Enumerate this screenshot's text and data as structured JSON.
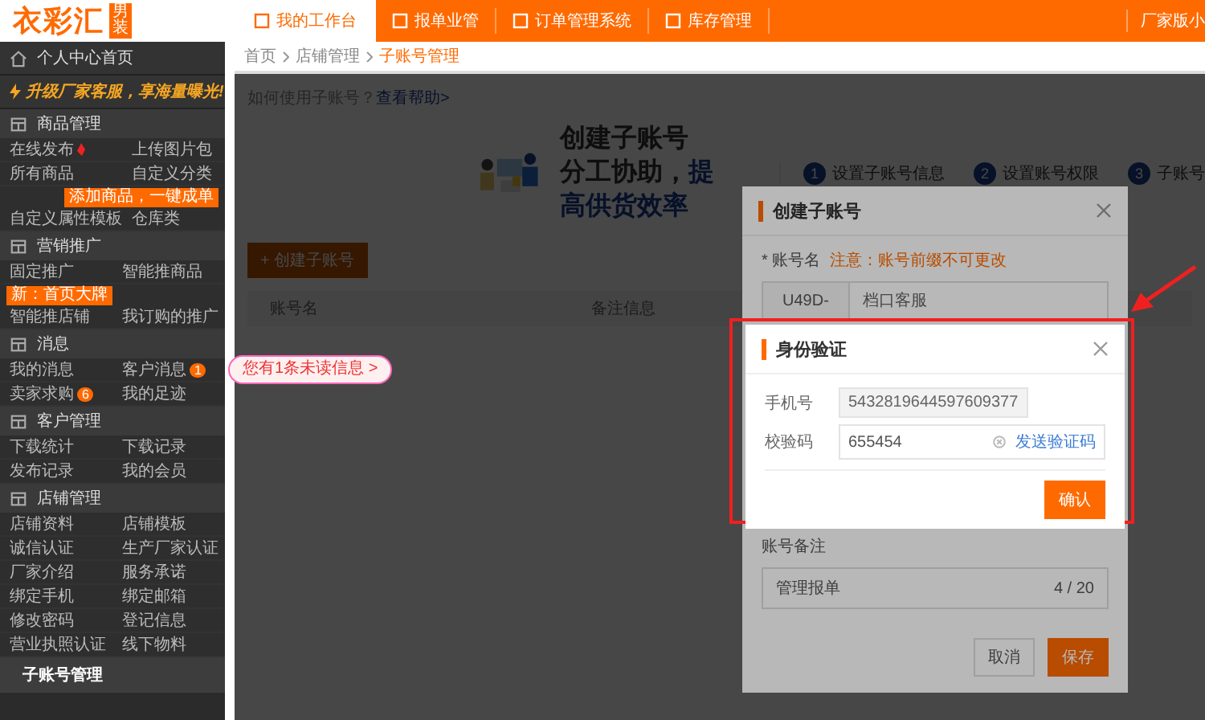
{
  "header": {
    "logo": "衣彩汇",
    "logo_tag": "男装",
    "tabs": [
      {
        "label": "我的工作台",
        "selected": true
      },
      {
        "label": "报单业管",
        "selected": false
      },
      {
        "label": "订单管理系统",
        "selected": false
      },
      {
        "label": "库存管理",
        "selected": false
      }
    ],
    "account": "厂家版小"
  },
  "sidebar": {
    "home": "个人中心首页",
    "promo": "升级厂家客服，享海量曝光!",
    "sections": [
      {
        "title": "商品管理",
        "items": [
          {
            "label": "在线发布",
            "hot": true
          },
          {
            "label": "上传图片包"
          },
          {
            "label": "所有商品"
          },
          {
            "label": "自定义分类",
            "tip": {
              "kind": "label",
              "text": "添加商品，一键成单"
            }
          },
          {
            "label": "自定义属性模板"
          },
          {
            "label": "仓库类"
          }
        ]
      },
      {
        "title": "营销推广",
        "items": [
          {
            "label": "固定推广",
            "tip": {
              "kind": "label",
              "text": "新：首页大牌"
            }
          },
          {
            "label": "智能推商品"
          },
          {
            "label": "智能推店铺"
          },
          {
            "label": "我订购的推广"
          }
        ]
      },
      {
        "title": "消息",
        "items": [
          {
            "label": "我的消息"
          },
          {
            "label": "客户消息",
            "badge": "1",
            "tip": {
              "kind": "bubble",
              "text": "您有1条未读信息 >"
            }
          },
          {
            "label": "卖家求购",
            "badge": "6"
          },
          {
            "label": "我的足迹"
          }
        ]
      },
      {
        "title": "客户管理",
        "items": [
          {
            "label": "下载统计"
          },
          {
            "label": "下载记录"
          },
          {
            "label": "发布记录"
          },
          {
            "label": "我的会员"
          }
        ]
      },
      {
        "title": "店铺管理",
        "items": [
          {
            "label": "店铺资料"
          },
          {
            "label": "店铺模板"
          },
          {
            "label": "诚信认证"
          },
          {
            "label": "生产厂家认证"
          },
          {
            "label": "厂家介绍"
          },
          {
            "label": "服务承诺"
          },
          {
            "label": "绑定手机"
          },
          {
            "label": "绑定邮箱"
          },
          {
            "label": "修改密码"
          },
          {
            "label": "登记信息"
          },
          {
            "label": "营业执照认证"
          },
          {
            "label": "线下物料"
          }
        ]
      }
    ],
    "sub_account": {
      "label": "子账号管理",
      "selected": true
    }
  },
  "breadcrumb": [
    "首页",
    "店铺管理",
    "子账号管理"
  ],
  "page": {
    "help": "如何使用子账号？",
    "help_link": "查看帮助>",
    "hero_title": "创建子账号",
    "hero_sub": "分工协助，",
    "hero_sub_em": "提高供货效率",
    "steps": [
      {
        "number": "1",
        "label": "设置子账号信息"
      },
      {
        "number": "2",
        "label": "设置账号权限"
      },
      {
        "number": "3",
        "label": "子账号"
      }
    ],
    "create_button": "+ 创建子账号",
    "columns": [
      "账号名",
      "备注信息"
    ]
  },
  "create_dialog": {
    "title": "创建子账号",
    "name_label": "* 账号名",
    "name_note": "注意：账号前缀不可更改",
    "prefix": "U49D-",
    "name_value": "档口客服",
    "remark_label": "账号备注",
    "remark_value": "管理报单",
    "remark_count": "4 / 20",
    "cancel": "取消",
    "save": "保存"
  },
  "verify_dialog": {
    "title": "身份验证",
    "phone_label": "手机号",
    "phone": "5432819644597609377",
    "code_label": "校验码",
    "code": "655454",
    "send": "发送验证码",
    "confirm": "确认"
  }
}
